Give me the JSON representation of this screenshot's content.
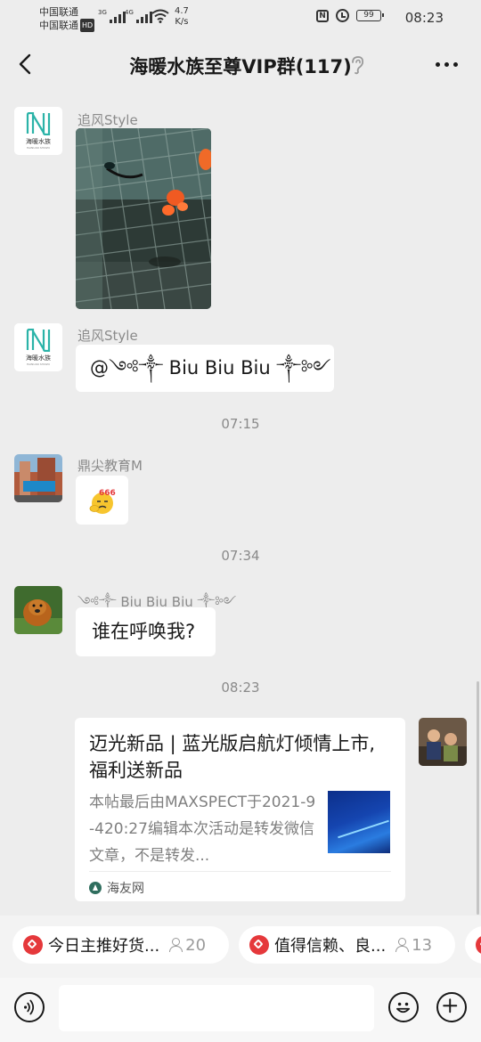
{
  "status_bar": {
    "carrier_1": "中国联通",
    "carrier_2": "中国联通",
    "hd": "HD",
    "sim1_network": "3G",
    "sim2_network": "4G",
    "net_speed_value": "4.7",
    "net_speed_unit": "K/s",
    "nfc": "N",
    "battery": "99",
    "time": "08:23"
  },
  "header": {
    "title": "海暖水族至尊VIP群(117)"
  },
  "messages": [
    {
      "sender": "追风Style",
      "type": "image",
      "avatar": "海暖水族 logo",
      "avatar_name": "海暖水族",
      "avatar_sub": "HAINUAN SHUIZU"
    },
    {
      "sender": "追风Style",
      "type": "text",
      "text": "@༺༒ Biu Biu Biu ༒༻",
      "avatar_name": "海暖水族",
      "avatar_sub": "HAINUAN SHUIZU"
    },
    {
      "type": "time",
      "text": "07:15"
    },
    {
      "sender": "鼎尖教育M",
      "type": "sticker",
      "sticker_text": "666"
    },
    {
      "type": "time",
      "text": "07:34"
    },
    {
      "sender": "༺༒ Biu Biu Biu ༒༻",
      "type": "text",
      "text": "谁在呼唤我?"
    },
    {
      "type": "time",
      "text": "08:23"
    },
    {
      "sender": "self",
      "type": "link_card",
      "title": "迈光新品 | 蓝光版启航灯倾情上市,福利送新品",
      "description": "本帖最后由MAXSPECT于2021-9-420:27编辑本次活动是转发微信文章，不是转发...",
      "source": "海友网"
    }
  ],
  "quick_chips": [
    {
      "label": "今日主推好货...",
      "count": "20"
    },
    {
      "label": "值得信赖、良...",
      "count": "13"
    }
  ],
  "input": {
    "value": "",
    "placeholder": ""
  },
  "icons": {
    "back": "back-arrow-icon",
    "mute": "ear-icon",
    "more": "more-dots-icon",
    "voice": "voice-icon",
    "emoji": "emoji-icon",
    "plus": "plus-icon",
    "chip": "red-diamond-icon",
    "members": "person-icon"
  },
  "colors": {
    "background": "#ededed",
    "bubble": "#ffffff",
    "chip_icon": "#e5383b"
  }
}
